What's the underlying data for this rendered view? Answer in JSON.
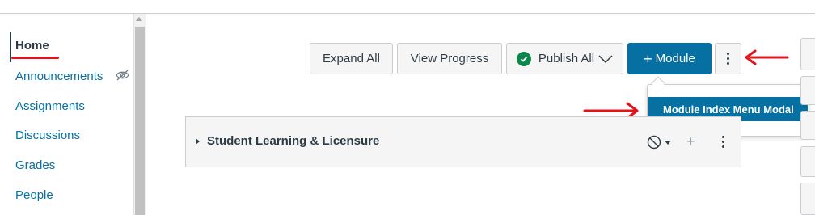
{
  "nav": {
    "items": [
      {
        "label": "Home",
        "active": true
      },
      {
        "label": "Announcements",
        "active": false,
        "hidden": true
      },
      {
        "label": "Assignments",
        "active": false
      },
      {
        "label": "Discussions",
        "active": false
      },
      {
        "label": "Grades",
        "active": false
      },
      {
        "label": "People",
        "active": false
      }
    ]
  },
  "toolbar": {
    "expand_all": "Expand All",
    "view_progress": "View Progress",
    "publish_all": "Publish All",
    "add_module": "Module",
    "add_module_icon": "plus-icon",
    "more_icon": "kebab-icon"
  },
  "menu": {
    "item": "Module Index Menu Modal"
  },
  "module": {
    "title": "Student Learning & Licensure",
    "status_icon": "unpublished-icon"
  },
  "colors": {
    "link": "#0770a3",
    "primary": "#0770a3",
    "published": "#0b874b",
    "annotation": "#e0141a",
    "text": "#2d3b45"
  }
}
